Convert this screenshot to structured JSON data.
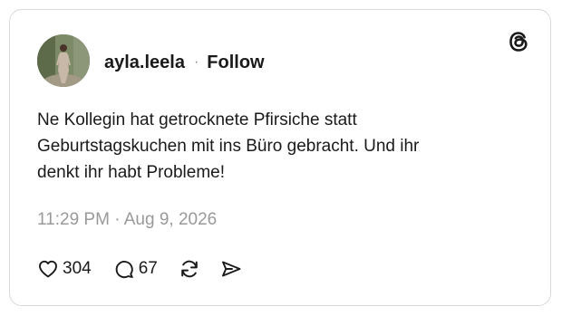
{
  "post": {
    "username": "ayla.leela",
    "separator": "·",
    "follow_label": "Follow",
    "text": "Ne Kollegin hat getrocknete Pfirsiche statt\nGeburtstagskuchen mit ins Büro gebracht. Und ihr\ndenkt ihr habt Probleme!",
    "timestamp": "11:29 PM · Aug 9, 2026",
    "likes": "304",
    "replies": "67"
  },
  "icons": {
    "brand": "threads-logo-icon",
    "like": "heart-icon",
    "reply": "speech-bubble-icon",
    "repost": "repost-icon",
    "share": "send-icon"
  },
  "colors": {
    "text": "#1a1a1a",
    "muted": "#999999",
    "border": "#d9d9d9"
  }
}
